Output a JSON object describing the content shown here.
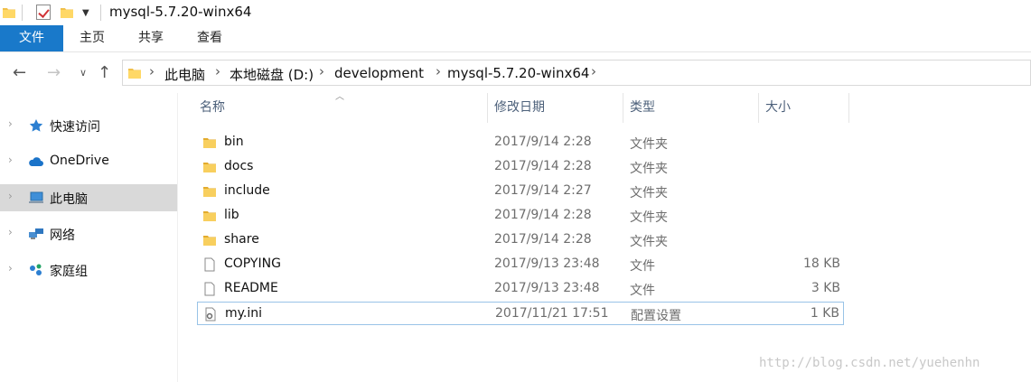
{
  "window": {
    "title": "mysql-5.7.20-winx64"
  },
  "ribbon": {
    "tabs": [
      "文件",
      "主页",
      "共享",
      "查看"
    ]
  },
  "address": {
    "crumbs": [
      "此电脑",
      "本地磁盘 (D:)",
      "development",
      "mysql-5.7.20-winx64"
    ]
  },
  "sidebar": {
    "items": [
      {
        "label": "快速访问",
        "icon": "star-icon"
      },
      {
        "label": "OneDrive",
        "icon": "cloud-icon"
      },
      {
        "label": "此电脑",
        "icon": "computer-icon"
      },
      {
        "label": "网络",
        "icon": "network-icon"
      },
      {
        "label": "家庭组",
        "icon": "homegroup-icon"
      }
    ]
  },
  "columns": [
    "名称",
    "修改日期",
    "类型",
    "大小"
  ],
  "files": [
    {
      "name": "bin",
      "date": "2017/9/14 2:28",
      "type": "文件夹",
      "size": "",
      "icon": "folder-icon"
    },
    {
      "name": "docs",
      "date": "2017/9/14 2:28",
      "type": "文件夹",
      "size": "",
      "icon": "folder-icon"
    },
    {
      "name": "include",
      "date": "2017/9/14 2:27",
      "type": "文件夹",
      "size": "",
      "icon": "folder-icon"
    },
    {
      "name": "lib",
      "date": "2017/9/14 2:28",
      "type": "文件夹",
      "size": "",
      "icon": "folder-icon"
    },
    {
      "name": "share",
      "date": "2017/9/14 2:28",
      "type": "文件夹",
      "size": "",
      "icon": "folder-icon"
    },
    {
      "name": "COPYING",
      "date": "2017/9/13 23:48",
      "type": "文件",
      "size": "18 KB",
      "icon": "file-icon"
    },
    {
      "name": "README",
      "date": "2017/9/13 23:48",
      "type": "文件",
      "size": "3 KB",
      "icon": "file-icon"
    },
    {
      "name": "my.ini",
      "date": "2017/11/21 17:51",
      "type": "配置设置",
      "size": "1 KB",
      "icon": "config-file-icon"
    }
  ],
  "watermark": "http://blog.csdn.net/yuehenhn",
  "colors": {
    "accent": "#1979ca",
    "folder": "#f1c04a",
    "selected_bg": "#d9d9d9"
  }
}
